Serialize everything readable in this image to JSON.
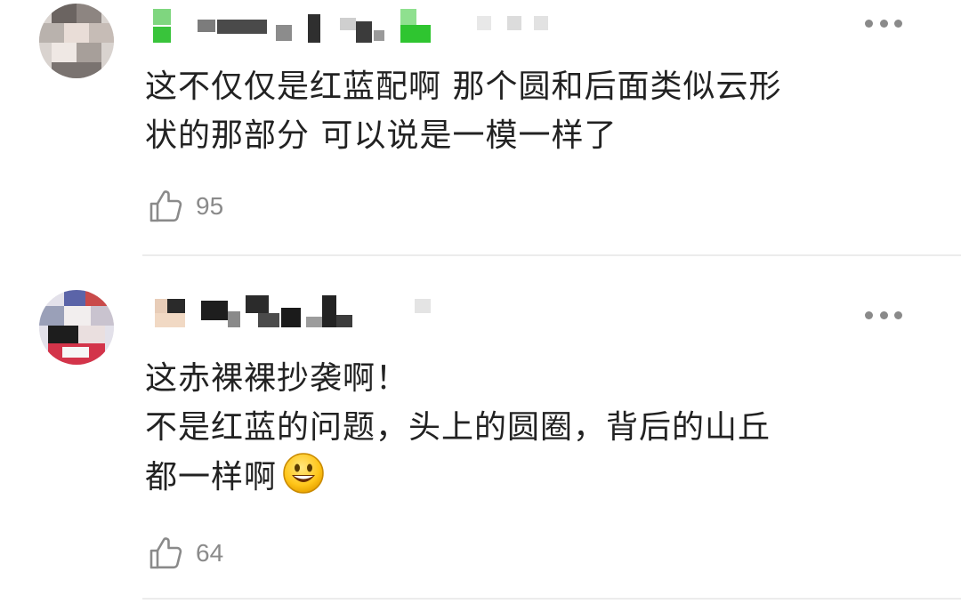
{
  "comments": [
    {
      "text_lines": [
        "这不仅仅是红蓝配啊 那个圆和后面类似云形",
        "状的那部分 可以说是一模一样了"
      ],
      "likes": "95",
      "like_icon": "thumbs-up-icon",
      "more_icon": "more-dots-icon"
    },
    {
      "text_lines": [
        "这赤裸裸抄袭啊！",
        "不是红蓝的问题，头上的圆圈，背后的山丘",
        "都一样啊"
      ],
      "emoji": "smiley-emoji-icon",
      "likes": "64",
      "like_icon": "thumbs-up-icon",
      "more_icon": "more-dots-icon"
    }
  ],
  "colors": {
    "text": "#222222",
    "meta": "#8a8a8a",
    "divider": "#ececec",
    "username_green": "#39c43b"
  }
}
